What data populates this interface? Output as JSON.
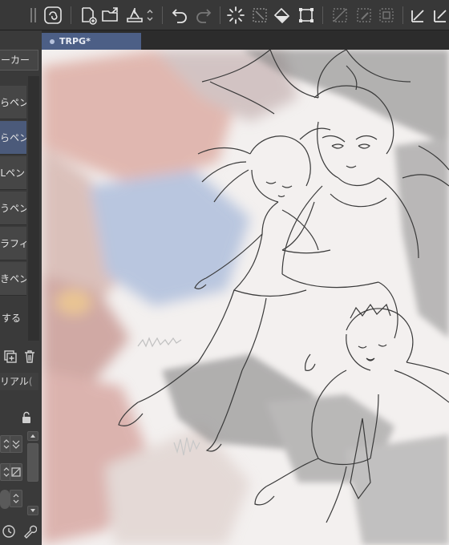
{
  "toolbar": {
    "buttons": [
      "clip-studio-icon",
      "new-file-icon",
      "open-file-icon",
      "save-icon",
      "undo-icon",
      "redo-icon",
      "loading-icon",
      "transform-icon",
      "fill-icon",
      "crop-icon",
      "grid-icon",
      "edit-icon",
      "frame-icon",
      "ruler-icon",
      "snap-icon"
    ]
  },
  "subtool": {
    "group_title": "ーカー",
    "items": [
      "らペン",
      "らペン",
      "Lペン",
      "うペン",
      "ラフィ",
      "きペン",
      "する"
    ],
    "selected_index": 1,
    "property_tab": "リアル",
    "property_tab_extra": "("
  },
  "canvas": {
    "tab_title": "TRPG*"
  },
  "colors": {
    "toolbar_bg": "#383838",
    "panel_bg": "#3a3a3a",
    "selection": "#4b5a7a",
    "tab_active": "#4c5f86"
  }
}
